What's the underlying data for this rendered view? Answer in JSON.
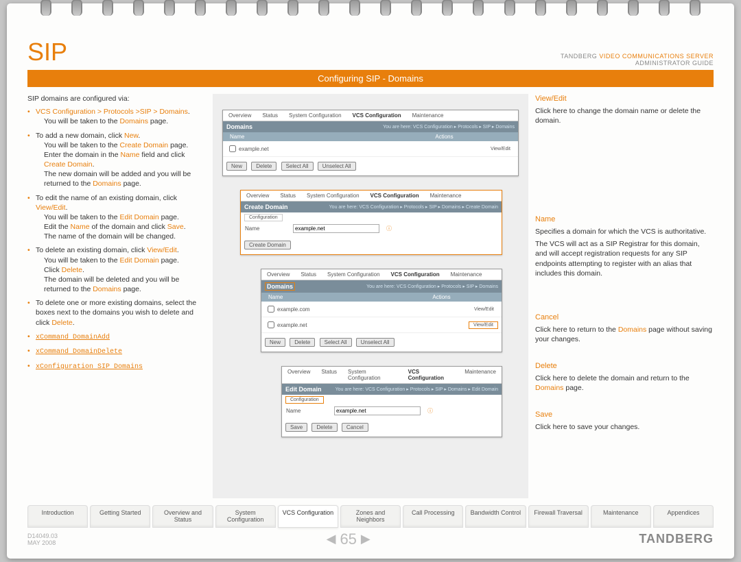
{
  "header": {
    "title": "SIP",
    "brand": "TANDBERG",
    "product": "VIDEO COMMUNICATIONS SERVER",
    "doc_type": "ADMINISTRATOR GUIDE"
  },
  "section_title": "Configuring SIP - Domains",
  "left": {
    "intro": "SIP domains are configured via:",
    "nav_path": "VCS Configuration > Protocols >SIP > Domains",
    "nav_note_a": "You will be  taken to the ",
    "nav_note_b": "Domains",
    "nav_note_c": " page.",
    "add_a": "To add a new domain, click ",
    "add_link": "New",
    "add_b": ".",
    "add_l2a": "You will be taken to the ",
    "add_l2b": "Create Domain",
    "add_l2c": " page.",
    "add_l3a": "Enter the domain in the ",
    "add_l3b": "Name",
    "add_l3c": " field and click ",
    "add_l3d": "Create Domain",
    "add_l3e": ".",
    "add_l4a": "The new domain will be added and you will be returned to the ",
    "add_l4b": "Domains",
    "add_l4c": " page.",
    "edit_a": "To edit the name of an existing domain, click ",
    "edit_link": "View/Edit",
    "edit_b": ".",
    "edit_l2a": "You will be taken to the ",
    "edit_l2b": "Edit Domain",
    "edit_l2c": " page.",
    "edit_l3a": "Edit the ",
    "edit_l3b": "Name",
    "edit_l3c": " of the domain and click ",
    "edit_l3d": "Save",
    "edit_l3e": ".",
    "edit_l4": "The name of the domain will be changed.",
    "del_a": "To delete an existing domain, click ",
    "del_link": "View/Edit",
    "del_b": ".",
    "del_l2a": "You will be taken to the ",
    "del_l2b": "Edit Domain",
    "del_l2c": " page.",
    "del_l3a": "Click ",
    "del_l3b": "Delete",
    "del_l3c": ".",
    "del_l4a": "The domain will be deleted and you will be returned to the ",
    "del_l4b": "Domains",
    "del_l4c": " page.",
    "multi_a": "To delete one or more existing domains, select the boxes next to the domains you wish to delete and click ",
    "multi_b": "Delete",
    "multi_c": ".",
    "cmd1": "xCommand DomainAdd",
    "cmd2": "xCommand DomainDelete",
    "cmd3": "xConfiguration SIP Domains"
  },
  "center": {
    "tabs": [
      "Overview",
      "Status",
      "System Configuration",
      "VCS Configuration",
      "Maintenance"
    ],
    "ss1": {
      "title": "Domains",
      "breadcrumb": "You are here: VCS Configuration ▸ Protocols ▸ SIP ▸ Domains",
      "col1": "Name",
      "col2": "Actions",
      "row1_name": "example.net",
      "row1_action": "View/Edit",
      "btn_new": "New",
      "btn_delete": "Delete",
      "btn_sel": "Select All",
      "btn_unsel": "Unselect All"
    },
    "ss2": {
      "title": "Create Domain",
      "breadcrumb": "You are here: VCS Configuration ▸ Protocols ▸ SIP ▸ Domains ▸ Create Domain",
      "tab": "Configuration",
      "field": "Name",
      "value": "example.net",
      "btn": "Create Domain"
    },
    "ss3": {
      "title": "Domains",
      "breadcrumb": "You are here: VCS Configuration ▸ Protocols ▸ SIP ▸ Domains",
      "col1": "Name",
      "col2": "Actions",
      "r1": "example.com",
      "r1a": "View/Edit",
      "r2": "example.net",
      "r2a": "View/Edit",
      "btn_new": "New",
      "btn_delete": "Delete",
      "btn_sel": "Select All",
      "btn_unsel": "Unselect All"
    },
    "ss4": {
      "title": "Edit Domain",
      "breadcrumb": "You are here: VCS Configuration ▸ Protocols ▸ SIP ▸ Domains ▸ Edit Domain",
      "tab": "Configuration",
      "field": "Name",
      "value": "example.net",
      "btn_save": "Save",
      "btn_delete": "Delete",
      "btn_cancel": "Cancel"
    }
  },
  "right": {
    "view_edit_h": "View/Edit",
    "view_edit_t": "Click here to change the domain name or delete the domain.",
    "name_h": "Name",
    "name_t1": "Specifies a domain for which the VCS is authoritative.",
    "name_t2": "The VCS will act as a SIP Registrar for this domain, and will accept registration requests for any SIP endpoints attempting to register with an alias that includes this domain.",
    "cancel_h": "Cancel",
    "cancel_t_a": "Click here to return to the ",
    "cancel_t_b": "Domains",
    "cancel_t_c": " page without saving your changes.",
    "delete_h": "Delete",
    "delete_t_a": "Click here to delete the domain and return to the ",
    "delete_t_b": "Domains",
    "delete_t_c": " page.",
    "save_h": "Save",
    "save_t": "Click here to save your changes."
  },
  "nav_tabs": [
    "Introduction",
    "Getting Started",
    "Overview and Status",
    "System Configuration",
    "VCS Configuration",
    "Zones and Neighbors",
    "Call Processing",
    "Bandwidth Control",
    "Firewall Traversal",
    "Maintenance",
    "Appendices"
  ],
  "active_tab_index": 4,
  "footer": {
    "docid": "D14049.03",
    "date": "MAY 2008",
    "page": "65",
    "logo": "TANDBERG"
  }
}
